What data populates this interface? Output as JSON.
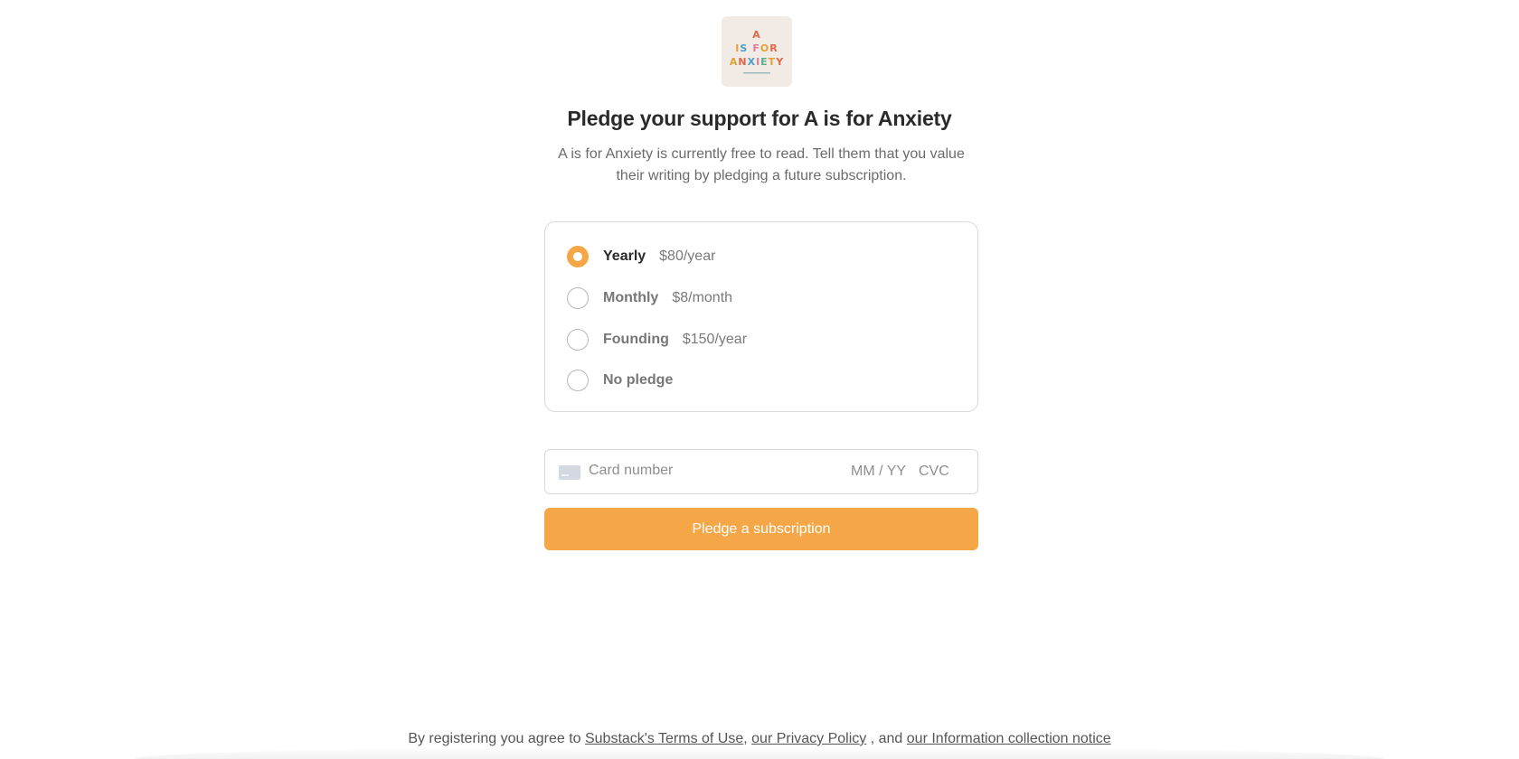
{
  "logo": {
    "lines": [
      [
        {
          "char": "A",
          "color": "#e06a48"
        }
      ],
      [
        {
          "char": "I",
          "color": "#e0a13a"
        },
        {
          "char": "S",
          "color": "#4a9fc8"
        },
        {
          "char": " ",
          "color": "#000000"
        },
        {
          "char": "F",
          "color": "#e07a9a"
        },
        {
          "char": "O",
          "color": "#e0a13a"
        },
        {
          "char": "R",
          "color": "#e06a48"
        }
      ],
      [
        {
          "char": "A",
          "color": "#e0a13a"
        },
        {
          "char": "N",
          "color": "#e06a48"
        },
        {
          "char": "X",
          "color": "#4a9fc8"
        },
        {
          "char": "I",
          "color": "#e07a9a"
        },
        {
          "char": "E",
          "color": "#5bb089"
        },
        {
          "char": "T",
          "color": "#e0a13a"
        },
        {
          "char": "Y",
          "color": "#e06a48"
        }
      ]
    ],
    "background": "#f2ebe5"
  },
  "header": {
    "title": "Pledge your support for A is for Anxiety",
    "subtitle": "A is for Anxiety is currently free to read. Tell them that you value their writing by pledging a future subscription."
  },
  "plans": [
    {
      "name": "Yearly",
      "price": "$80/year",
      "selected": true
    },
    {
      "name": "Monthly",
      "price": "$8/month",
      "selected": false
    },
    {
      "name": "Founding",
      "price": "$150/year",
      "selected": false
    },
    {
      "name": "No pledge",
      "price": "",
      "selected": false
    }
  ],
  "card": {
    "number_placeholder": "Card number",
    "expiry_placeholder": "MM / YY",
    "cvc_placeholder": "CVC"
  },
  "cta": {
    "label": "Pledge a subscription",
    "color": "#f5a647"
  },
  "footer": {
    "prefix": "By registering you agree to ",
    "terms": "Substack's Terms of Use",
    "sep1": ", ",
    "privacy": "our Privacy Policy",
    "sep2": " , and ",
    "info": "our Information collection notice"
  }
}
